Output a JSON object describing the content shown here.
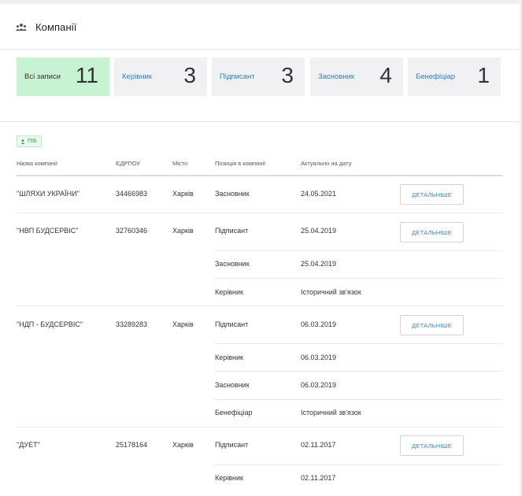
{
  "page": {
    "title": "Компанії",
    "title_icon": "people-group-icon"
  },
  "tabs": [
    {
      "label": "Всі записи",
      "count": "11",
      "active": true
    },
    {
      "label": "Керівник",
      "count": "3"
    },
    {
      "label": "Підписант",
      "count": "3"
    },
    {
      "label": "Засновник",
      "count": "4"
    },
    {
      "label": "Бенефіціар",
      "count": "1"
    }
  ],
  "filter": {
    "chip_label": "ПІБ",
    "chip_icon": "person-icon"
  },
  "table": {
    "headers": [
      "Назва компанії",
      "ЄДРПОУ",
      "Місто",
      "Позиція в компанії",
      "Актуально на дату"
    ],
    "button_label": "ДЕТАЛЬНІШЕ",
    "rows": [
      {
        "name": "\"ШЛЯХИ УКРАЇНИ\"",
        "code": "34466983",
        "city": "Харків",
        "positions": [
          {
            "role": "Засновник",
            "date": "24.05.2021"
          }
        ]
      },
      {
        "name": "\"НВП БУДСЕРВІС\"",
        "code": "32760346",
        "city": "Харків",
        "positions": [
          {
            "role": "Підписант",
            "date": "25.04.2019"
          },
          {
            "role": "Засновник",
            "date": "25.04.2019"
          },
          {
            "role": "Керівник",
            "date": "Історичний зв'язок"
          }
        ]
      },
      {
        "name": "\"НДП - БУДСЕРВІС\"",
        "code": "33289283",
        "city": "Харків",
        "positions": [
          {
            "role": "Підписант",
            "date": "06.03.2019"
          },
          {
            "role": "Керівник",
            "date": "06.03.2019"
          },
          {
            "role": "Засновник",
            "date": "06.03.2019"
          },
          {
            "role": "Бенефіціар",
            "date": "Історичний зв'язок"
          }
        ]
      },
      {
        "name": "\"ДУЕТ\"",
        "code": "25178164",
        "city": "Харків",
        "positions": [
          {
            "role": "Підписант",
            "date": "02.11.2017"
          },
          {
            "role": "Керівник",
            "date": "02.11.2017"
          }
        ]
      }
    ]
  },
  "colors": {
    "active_tile": "#c8f3d3",
    "link": "#2f7fc1",
    "chip_text": "#3c9b57"
  }
}
